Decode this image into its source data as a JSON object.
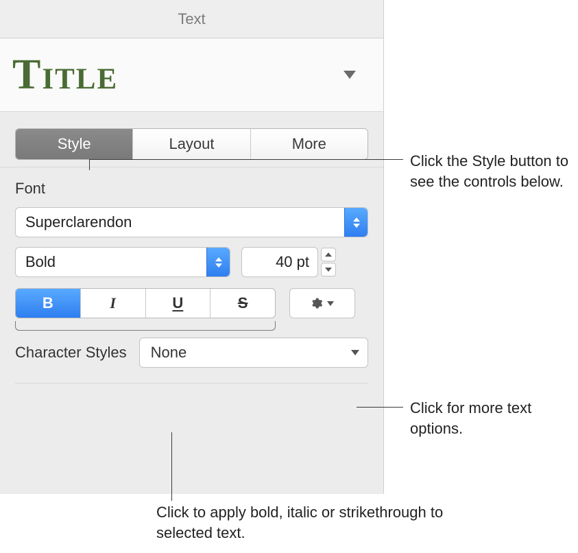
{
  "header": {
    "title": "Text"
  },
  "paragraph_style": {
    "name": "Title"
  },
  "tabs": {
    "style": "Style",
    "layout": "Layout",
    "more": "More",
    "active": "style"
  },
  "font": {
    "section_label": "Font",
    "family": "Superclarendon",
    "weight": "Bold",
    "size_display": "40 pt"
  },
  "format_buttons": {
    "bold": "B",
    "italic": "I",
    "underline": "U",
    "strike": "S",
    "active": "bold"
  },
  "character_styles": {
    "label": "Character Styles",
    "value": "None"
  },
  "callouts": {
    "style_tab": "Click the Style button to see the controls below.",
    "more_options": "Click for more text options.",
    "bius": "Click to apply bold, italic or strikethrough to selected text."
  }
}
